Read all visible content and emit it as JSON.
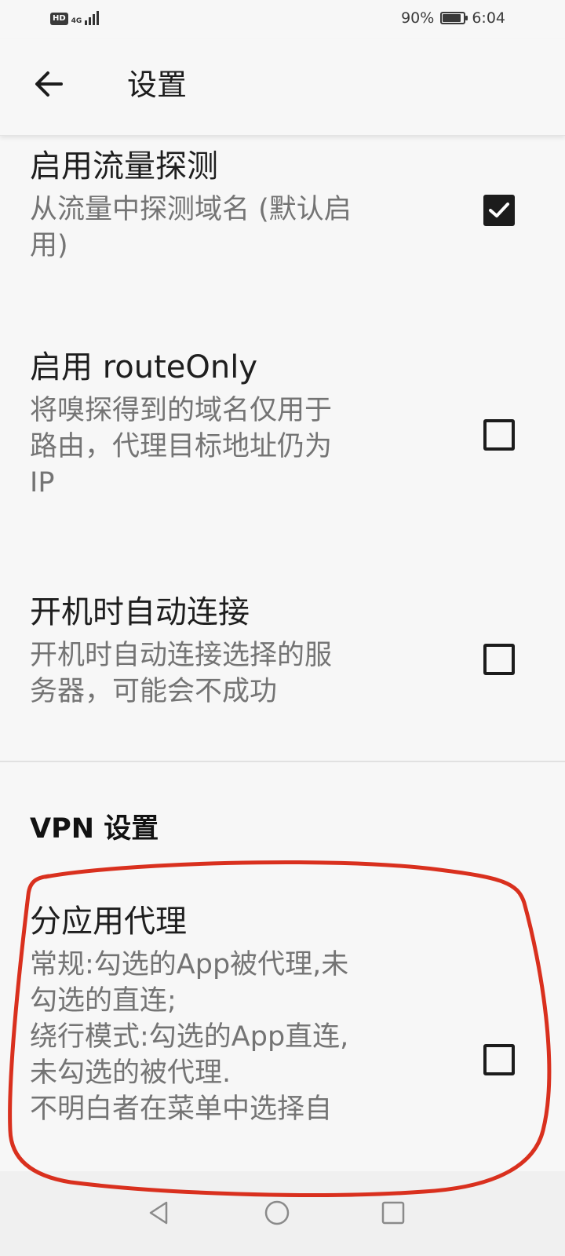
{
  "status_bar": {
    "hd_label": "HD",
    "network_label": "4G",
    "battery_text": "90%",
    "battery_level": 0.9,
    "time": "6:04"
  },
  "app_bar": {
    "back_icon": "arrow-left-icon",
    "title": "设置"
  },
  "preferences": [
    {
      "title": "启用流量探测",
      "summary_lines": [
        "从流量中探测域名 (默认启",
        "用)"
      ],
      "checked": true
    },
    {
      "title": "启用 routeOnly",
      "summary_lines": [
        "将嗅探得到的域名仅用于",
        "路由，代理目标地址仍为",
        "IP"
      ],
      "checked": false
    },
    {
      "title": "开机时自动连接",
      "summary_lines": [
        "开机时自动连接选择的服",
        "务器，可能会不成功"
      ],
      "checked": false
    }
  ],
  "vpn_section": {
    "header": "VPN 设置",
    "per_app": {
      "title": "分应用代理",
      "summary_lines": [
        "常规:勾选的App被代理,未",
        "勾选的直连;",
        "绕行模式:勾选的App直连,",
        "未勾选的被代理.",
        "不明白者在菜单中选择自"
      ],
      "checked": false
    }
  },
  "annotation": {
    "color": "#d9301e"
  },
  "nav_bar": {
    "back_icon": "triangle-back-icon",
    "home_icon": "circle-home-icon",
    "recents_icon": "square-recents-icon"
  }
}
